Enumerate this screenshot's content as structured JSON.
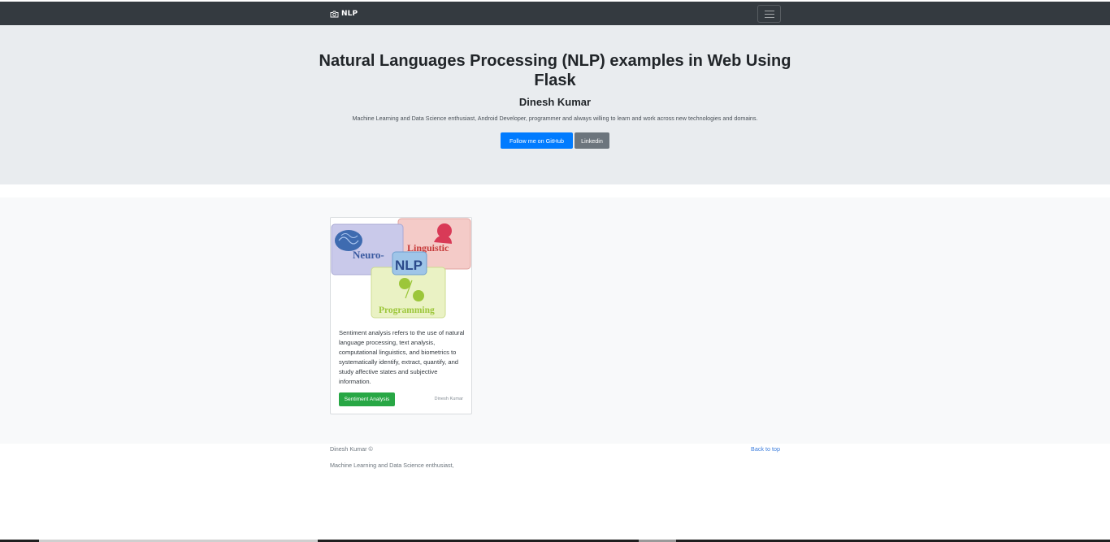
{
  "navbar": {
    "brand": "NLP",
    "brand_icon": "camera-icon",
    "toggler_icon": "hamburger-menu-icon"
  },
  "jumbotron": {
    "title": "Natural Languages Processing (NLP) examples in Web Using Flask",
    "subtitle": "Dinesh Kumar",
    "lead": "Machine Learning and Data Science enthusiast, Android Developer, programmer and always willing to learn and work across new technologies and domains.",
    "github_button": "Follow me on GitHub",
    "linkedin_button": "Linkedin"
  },
  "card": {
    "image": {
      "neuro": "Neuro-",
      "linguistic": "Linguistic",
      "nlp": "NLP",
      "programming": "Programming"
    },
    "text": "Sentiment analysis refers to the use of natural language processing, text analysis, computational linguistics, and biometrics to systematically identify, extract, quantify, and study affective states and subjective information.",
    "button": "Sentiment Analysis",
    "author": "Dinesh Kumar"
  },
  "footer": {
    "copyright": "Dinesh Kumar ©",
    "description": "Machine Learning and Data Science enthusiast,",
    "back_to_top": "Back to top"
  },
  "colors": {
    "navbar": "#343a40",
    "jumbotron": "#e9ecef",
    "primary": "#007bff",
    "secondary": "#6c757d",
    "success": "#28a745"
  }
}
